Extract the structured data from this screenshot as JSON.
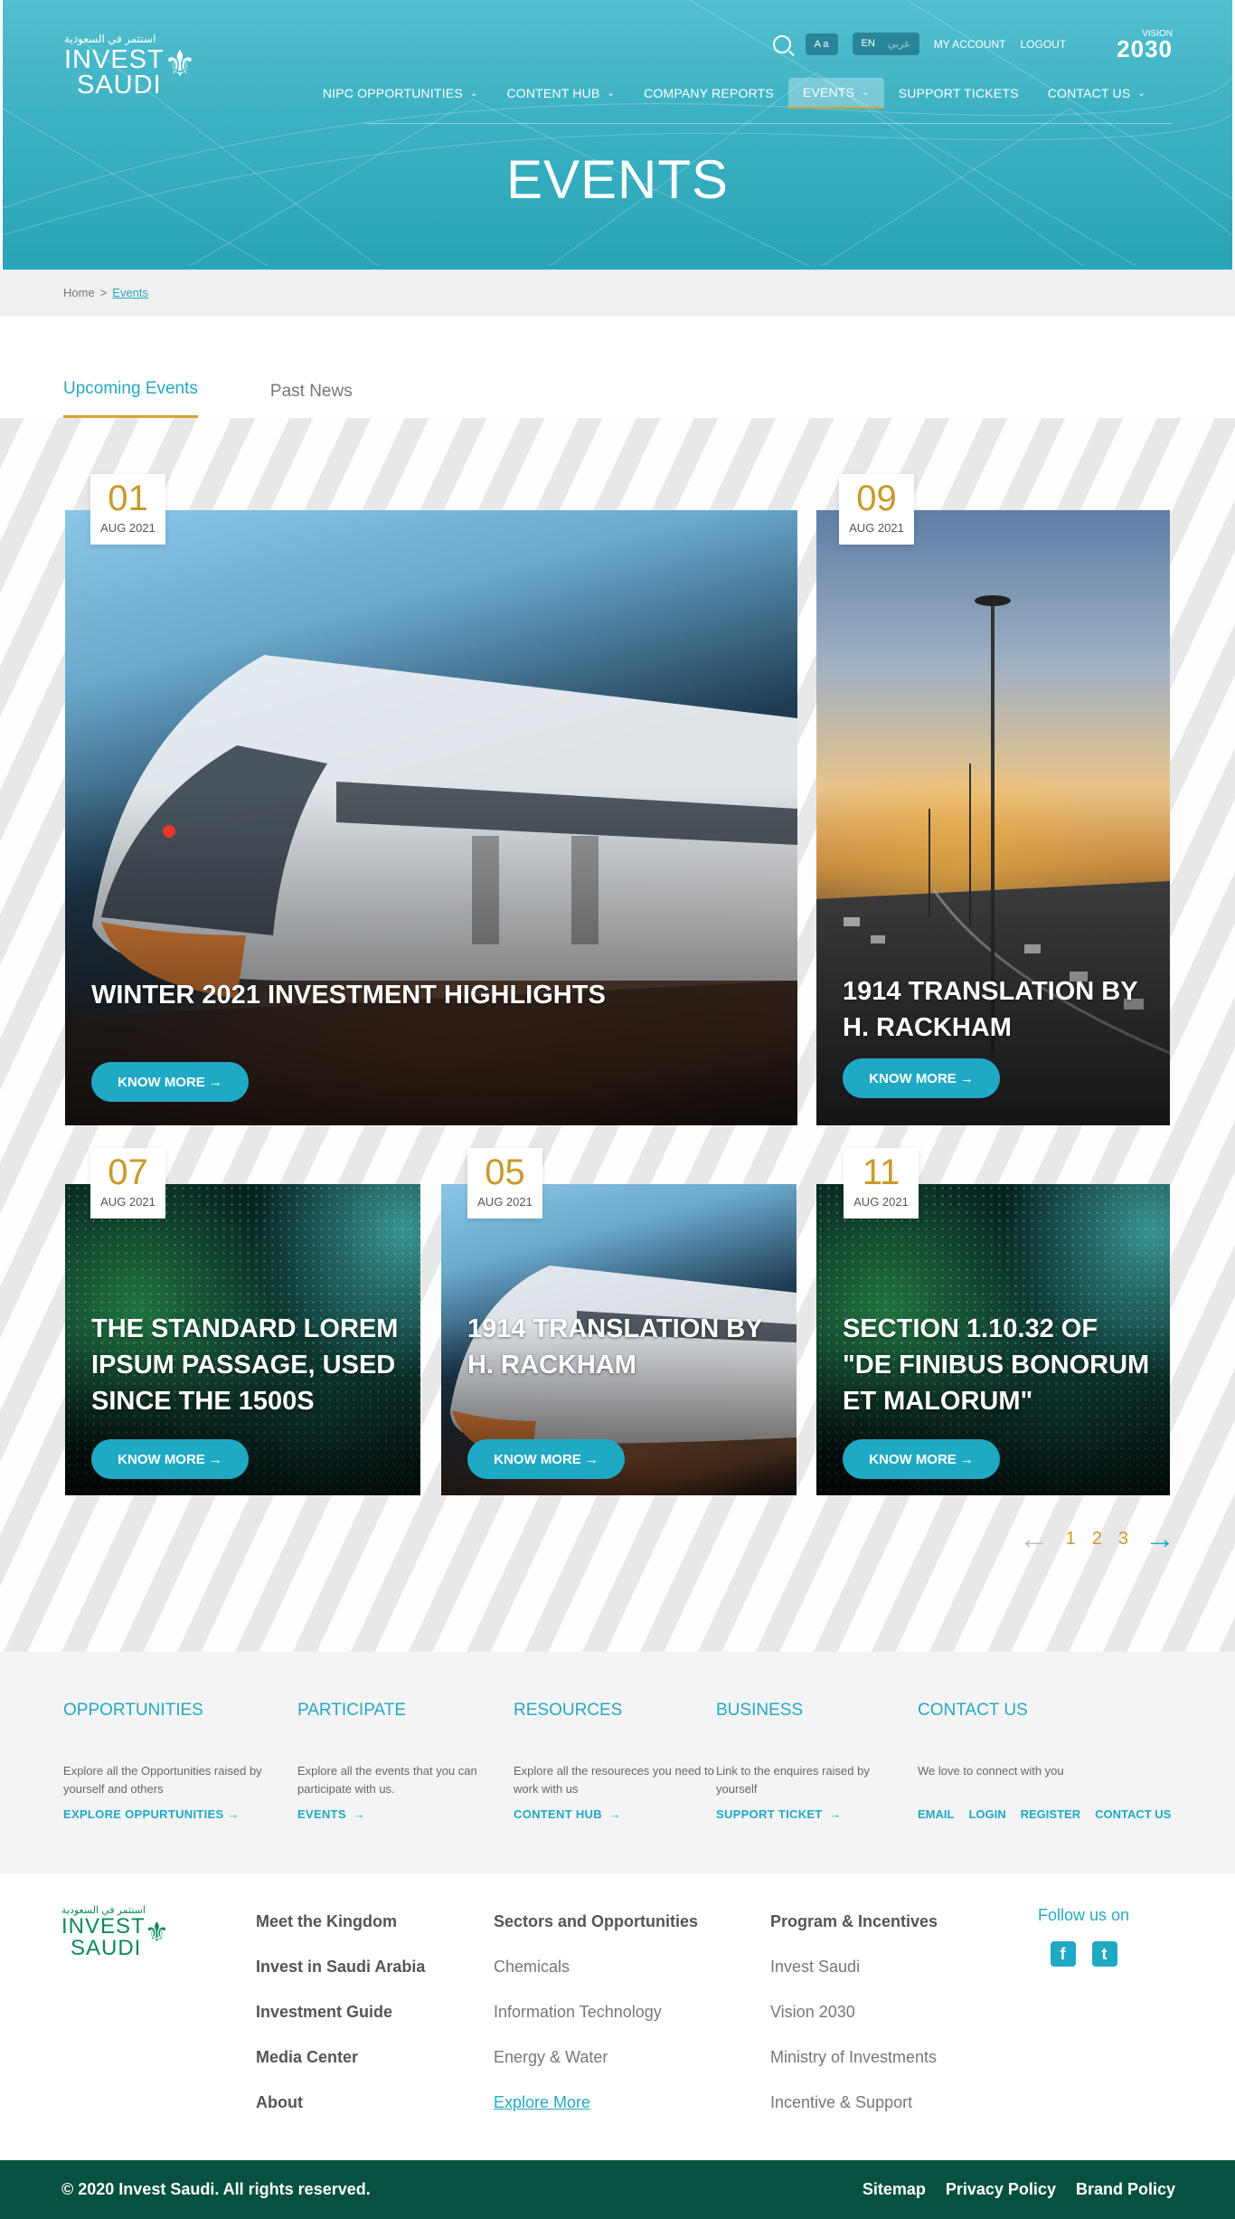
{
  "header": {
    "logo_arabic": "استثمر في السعودية",
    "logo_line1": "INVEST",
    "logo_line2": "SAUDI",
    "font_size_label": "A a",
    "lang_en": "EN",
    "lang_ar": "عربي",
    "my_account": "MY ACCOUNT",
    "logout": "LOGOUT",
    "vision_label": "VISION",
    "vision_year": "2030",
    "nav": [
      {
        "label": "NIPC OPPORTUNITIES",
        "dropdown": true
      },
      {
        "label": "CONTENT HUB",
        "dropdown": true
      },
      {
        "label": "COMPANY REPORTS",
        "dropdown": false
      },
      {
        "label": "EVENTS",
        "dropdown": true,
        "active": true
      },
      {
        "label": "SUPPORT TICKETS",
        "dropdown": false
      },
      {
        "label": "CONTACT US",
        "dropdown": true
      }
    ],
    "page_title": "EVENTS"
  },
  "breadcrumb": {
    "home": "Home",
    "separator": ">",
    "current": "Events"
  },
  "tabs": [
    {
      "label": "Upcoming Events",
      "active": true
    },
    {
      "label": "Past News",
      "active": false
    }
  ],
  "events": [
    {
      "day": "01",
      "month": "AUG 2021",
      "title": "WINTER 2021 INVESTMENT HIGHLIGHTS",
      "button": "KNOW MORE",
      "image": "train"
    },
    {
      "day": "09",
      "month": "AUG 2021",
      "title": "1914 TRANSLATION BY H. RACKHAM",
      "button": "KNOW MORE",
      "image": "highway-sunset"
    },
    {
      "day": "07",
      "month": "AUG 2021",
      "title": "THE STANDARD LOREM IPSUM PASSAGE, USED SINCE THE 1500S",
      "button": "KNOW MORE",
      "image": "digital-globe"
    },
    {
      "day": "05",
      "month": "AUG 2021",
      "title": "1914 TRANSLATION BY H. RACKHAM",
      "button": "KNOW MORE",
      "image": "train"
    },
    {
      "day": "11",
      "month": "AUG 2021",
      "title": "SECTION 1.10.32 OF \"DE FINIBUS BONORUM ET MALORUM\"",
      "button": "KNOW MORE",
      "image": "digital-globe"
    }
  ],
  "pagination": {
    "pages": [
      "1",
      "2",
      "3"
    ],
    "prev_icon": "arrow-left-icon",
    "next_icon": "arrow-right-icon"
  },
  "links_band": [
    {
      "heading": "OPPORTUNITIES",
      "text": "Explore all the Opportunities raised by yourself and others",
      "cta": "EXPLORE OPPURTUNITIES"
    },
    {
      "heading": "PARTICIPATE",
      "text": "Explore all the events that you can participate with us.",
      "cta": "EVENTS"
    },
    {
      "heading": "RESOURCES",
      "text": "Explore all the resoureces you need to work with us",
      "cta": "CONTENT HUB"
    },
    {
      "heading": "BUSINESS",
      "text": "Link to the enquires raised by yourself",
      "cta": "SUPPORT TICKET"
    },
    {
      "heading": "CONTACT US",
      "text": "We love to connect with you",
      "links": [
        "EMAIL",
        "LOGIN",
        "REGISTER",
        "CONTACT US"
      ]
    }
  ],
  "footer": {
    "col1": [
      "Meet the Kingdom",
      "Invest in Saudi Arabia",
      "Investment Guide",
      "Media Center",
      "About"
    ],
    "col2_heading": "Sectors and Opportunities",
    "col2": [
      "Chemicals",
      "Information Technology",
      "Energy & Water"
    ],
    "col2_more": "Explore More",
    "col3_heading": "Program & Incentives",
    "col3": [
      "Invest Saudi",
      "Vision 2030",
      "Ministry of Investments",
      "Incentive & Support"
    ],
    "follow": "Follow us on",
    "social": [
      "facebook-icon",
      "twitter-icon"
    ],
    "copyright": "© 2020 Invest Saudi. All rights reserved.",
    "bottom_links": [
      "Sitemap",
      "Privacy Policy",
      "Brand Policy"
    ]
  },
  "colors": {
    "accent": "#26a8c2",
    "gold": "#c9992c",
    "footer_bar": "#075140",
    "logo_green": "#0a8a5a"
  }
}
